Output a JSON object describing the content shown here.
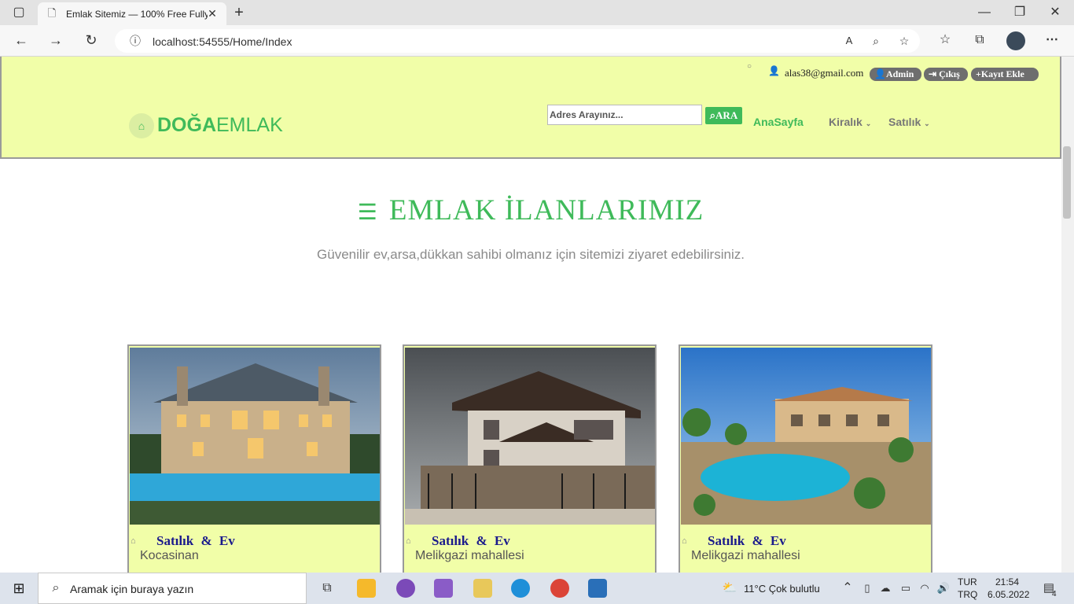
{
  "browser": {
    "tab_title": "Emlak Sitemiz — 100% Free Fully",
    "url": "localhost:54555/Home/Index"
  },
  "header": {
    "user_email": "alas38@gmail.com",
    "admin_btn": "Admin",
    "logout_btn": "Çıkış",
    "add_btn": "Kayıt Ekle",
    "logo_bold": "DOĞA",
    "logo_light": "EMLAK",
    "search_placeholder": "Adres Arayınız...",
    "search_btn": "ARA",
    "nav": [
      "AnaSayfa",
      "Kiralık",
      "Satılık"
    ]
  },
  "section": {
    "title": "EMLAK İLANLARIMIZ",
    "subtitle": "Güvenilir ev,arsa,dükkan sahibi olmanız için sitemizi ziyaret edebilirsiniz."
  },
  "listings": [
    {
      "title": "Satılık & Ev",
      "location": "Kocasinan",
      "image": "mansion-with-pool"
    },
    {
      "title": "Satılık & Ev",
      "location": "Melikgazi mahallesi",
      "image": "two-storey-house"
    },
    {
      "title": "Satılık & Ev",
      "location": "Melikgazi mahallesi",
      "image": "villa-with-pool"
    }
  ],
  "taskbar": {
    "search_placeholder": "Aramak için buraya yazın",
    "weather": "11°C  Çok bulutlu",
    "lang_top": "TUR",
    "lang_bottom": "TRQ",
    "time": "21:54",
    "date": "6.05.2022",
    "notifications": "4"
  },
  "colors": {
    "accent": "#3fba5a",
    "header_bg": "#f1fea8",
    "listing_title": "#1a1a8c"
  }
}
